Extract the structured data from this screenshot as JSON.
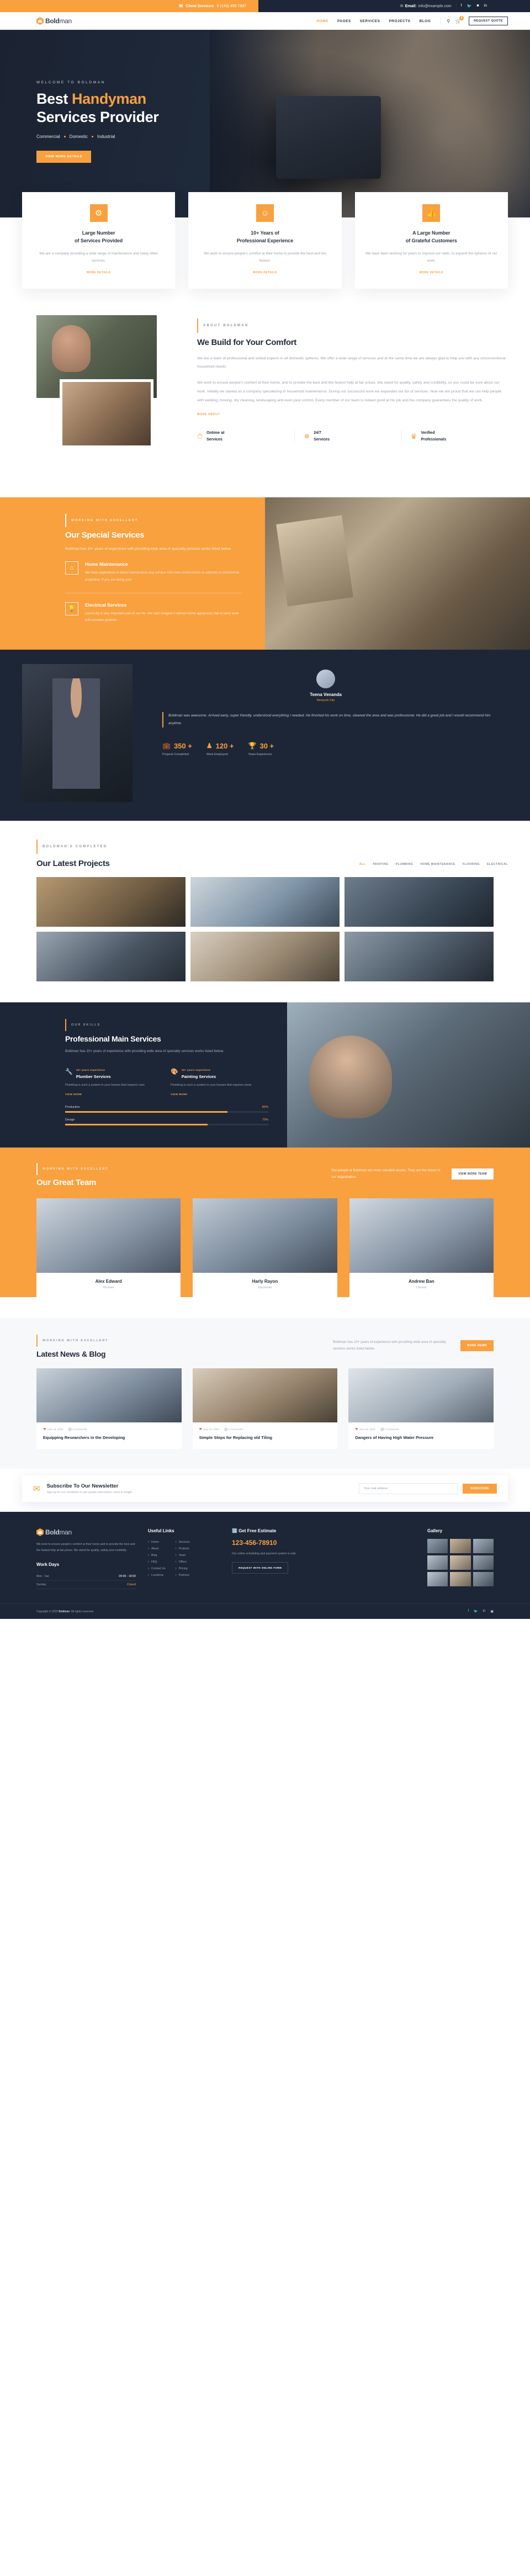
{
  "topbar": {
    "phone_icon": "phone-icon",
    "phone_label": "Client Services:",
    "phone_number": "0 (143) 456 7897",
    "mail_icon": "mail-icon",
    "email_label": "Email:",
    "email_value": "info@example.com",
    "socials": [
      "facebook-icon",
      "twitter-icon",
      "linkedin-square-icon",
      "linkedin-icon"
    ],
    "social_glyphs": [
      "f",
      "𝘁",
      "in",
      "in"
    ]
  },
  "nav": {
    "brand_bold": "Bold",
    "brand_light": "man",
    "menu": [
      {
        "label": "HOME",
        "active": true
      },
      {
        "label": "PAGES",
        "active": false
      },
      {
        "label": "SERVICES",
        "active": false
      },
      {
        "label": "PROJECTS",
        "active": false
      },
      {
        "label": "BLOG",
        "active": false
      }
    ],
    "search_icon": "search-icon",
    "cart_icon": "cart-icon",
    "cart_count": "0",
    "quote_button": "REQUEST QUOTE"
  },
  "hero": {
    "kicker": "WELCOME TO BOLDMAN",
    "title_line1_a": "Best ",
    "title_line1_b": "Handyman",
    "title_line2": "Services Provider",
    "tags": [
      "Commercial",
      "Domestic",
      "Industrial"
    ],
    "cta": "VIEW MORE DETAILS"
  },
  "features": [
    {
      "icon": "gear-icon",
      "title_l1": "Large Number",
      "title_l2": "of Services Provided",
      "text": "We are a company providing a wide range of maintenance and many other services.",
      "more": "MORE DETAILS"
    },
    {
      "icon": "user-tie-icon",
      "title_l1": "10+ Years of",
      "title_l2": "Professional Experience",
      "text": "We work to ensure people's comfort at their home to provide the best and the fastest.",
      "more": "MORE DETAILS"
    },
    {
      "icon": "thumbs-up-icon",
      "title_l1": "A Large Number",
      "title_l2": "of Grateful Customers",
      "text": "We have been working for years to improve our skills, to expand the spheres of our work.",
      "more": "MORE DETAILS"
    }
  ],
  "about": {
    "kicker": "ABOUT BOLDMAN",
    "title": "We Build for Your Comfort",
    "p1": "We are a team of professional and skilled experts in all domestic spheres. We offer a wide range of services and at the same time we are always glad to help you with any unconventional household needs:",
    "p2": "We work to ensure people's comfort at their home, and to provide the best and the fastest help at fair prices. We stand for quality, safety and credibility, so you could be sure about our work. Initially we started as a company specializing in household maintenance. During our successful work we expanded our list of services. Now we are proud that we can help people with welding, moving, dry cleaning, landscaping and even pest control. Every member of our team is indeed good at his job and the company guarantees the quality of work.",
    "more": "MORE ABOUT",
    "minifeatures": [
      {
        "icon": "stopwatch-icon",
        "l1": "Ontime at",
        "l2": "Services"
      },
      {
        "icon": "magic-wand-icon",
        "l1": "24/7",
        "l2": "Services"
      },
      {
        "icon": "badge-icon",
        "l1": "Verified",
        "l2": "Professionals"
      }
    ]
  },
  "special": {
    "kicker": "WORKING WITH EXCELLENT",
    "title": "Our Special Services",
    "subtitle": "Boldman has 10+ years of experience with providing wide area of specialty services works listed below.",
    "items": [
      {
        "icon": "home-icon",
        "title": "Home Maintenance",
        "text": "We have experience in home maintenance any surface from new constructions to cabinets in commercial properties. If you are doing your"
      },
      {
        "icon": "bulb-icon",
        "title": "Electrical Services",
        "text": "Electricity is very important part of our life. We can't imagine it without home appliances that in turns work with services provider"
      }
    ]
  },
  "testimonial": {
    "name": "Teena Venanda",
    "location": "Newyork City",
    "quote": "Boldman was awesome. Arrived early, super friendly, understood everything I needed. He finished his work on time, cleaned the area and was professional. He did a great job and I would recommend him anytime.",
    "stats": [
      {
        "icon": "briefcase-icon",
        "value": "350 +",
        "label": "Projects Completed"
      },
      {
        "icon": "user-icon",
        "value": "120 +",
        "label": "Work Employed"
      },
      {
        "icon": "trophy-icon",
        "value": "30 +",
        "label": "Years Experience"
      }
    ]
  },
  "projects": {
    "kicker": "BOLDMAN'S COMPLETED",
    "title": "Our Latest Projects",
    "tabs": [
      {
        "label": "ALL",
        "active": true
      },
      {
        "label": "PAINTING",
        "active": false
      },
      {
        "label": "PLUMBING",
        "active": false
      },
      {
        "label": "HOME MAINTENANCE",
        "active": false
      },
      {
        "label": "FLOORING",
        "active": false
      },
      {
        "label": "ELECTRICAL",
        "active": false
      }
    ],
    "items": [
      "project-1",
      "project-2",
      "project-3",
      "project-4",
      "project-5",
      "project-6"
    ]
  },
  "main_services": {
    "kicker": "OUR SKILLS",
    "title": "Professional Main Services",
    "subtitle": "Boldman has 10+ years of experience with providing wide area of specialty services works listed below.",
    "cards": [
      {
        "icon": "wrench-icon",
        "years": "10+ years experience",
        "title": "Plumber Services",
        "text": "Plumbing is such a system in your houses that requires care",
        "link": "VIEW MORE"
      },
      {
        "icon": "paint-roller-icon",
        "years": "10+ years experience",
        "title": "Painting Services",
        "text": "Plumbing is such a system in your houses that requires some",
        "link": "VIEW MORE"
      }
    ],
    "bars": [
      {
        "label": "Production",
        "value": "80%",
        "pct": 80
      },
      {
        "label": "Design",
        "value": "70%",
        "pct": 70
      }
    ]
  },
  "team": {
    "kicker": "WORKING WITH EXCELLENT",
    "title": "Our Great Team",
    "subtitle": "Our people at Boldman are more valuable assets. They are the future of our organization.",
    "button": "VIEW MORE TEAM",
    "members": [
      {
        "name": "Alex Edward",
        "role": "Plumber"
      },
      {
        "name": "Harly Rayon",
        "role": "Electrician"
      },
      {
        "name": "Andrew Ban",
        "role": "Cleaner"
      }
    ]
  },
  "blog": {
    "kicker": "WORKING WITH EXCELLENT",
    "title": "Latest News & Blog",
    "subtitle": "Boldman has 10+ years of experience with providing wide area of specialty services works listed below.",
    "button": "MORE NEWS",
    "posts": [
      {
        "date_icon": "calendar-icon",
        "date": "June 24, 2020",
        "comment_icon": "comment-icon",
        "comments": "2 Comments",
        "title": "Equipping Researchers in the Developing"
      },
      {
        "date_icon": "calendar-icon",
        "date": "June 24, 2020",
        "comment_icon": "comment-icon",
        "comments": "2 Comments",
        "title": "Simple Steps for Replacing old Tiling"
      },
      {
        "date_icon": "calendar-icon",
        "date": "June 24, 2020",
        "comment_icon": "comment-icon",
        "comments": "2 Comments",
        "title": "Dangers of Having High Water Pressure"
      }
    ]
  },
  "newsletter": {
    "icon": "envelope-icon",
    "title": "Subscribe To Our Newsletter",
    "subtitle": "Sign up for our newsletter to get update information, news & insight.",
    "placeholder": "Your mail address",
    "button": "SUBSCRIBE"
  },
  "footer": {
    "brand_bold": "Bold",
    "brand_light": "man",
    "about": "We work to ensure people's comfort at their home and to provide the best and the fastest help at fair prices. We stand for quality, safety and credibility.",
    "workdays_title": "Work Days",
    "workdays": [
      {
        "days": "Mon - Sat",
        "hours": "09:00 - 18:00",
        "closed": false
      },
      {
        "days": "Sunday",
        "hours": "Closed",
        "closed": true
      }
    ],
    "links_title": "Useful Links",
    "links_col1": [
      "Home",
      "About",
      "Blog",
      "FAQ",
      "Contact Us",
      "Locations"
    ],
    "links_col2": [
      "Services",
      "Projects",
      "Team",
      "Offers",
      "Pricing",
      "Partners"
    ],
    "estimate_icon": "calculator-icon",
    "estimate_title": "Get Free Estimate",
    "estimate_phone": "123-456-78910",
    "estimate_text": "Our online scheduling and payment system is safe.",
    "estimate_button": "REQUEST WITH ONLINE FORM",
    "gallery_title": "Gallery",
    "gallery": [
      "g1",
      "g2",
      "g3",
      "g4",
      "g5",
      "g6",
      "g7",
      "g8",
      "g9"
    ],
    "copyright_pre": "Copyright © 2020 ",
    "copyright_brand": "Boldman",
    "copyright_post": ". All rights reserved.",
    "socials": [
      "facebook-icon",
      "twitter-icon",
      "linkedin-square-icon",
      "instagram-icon"
    ]
  }
}
